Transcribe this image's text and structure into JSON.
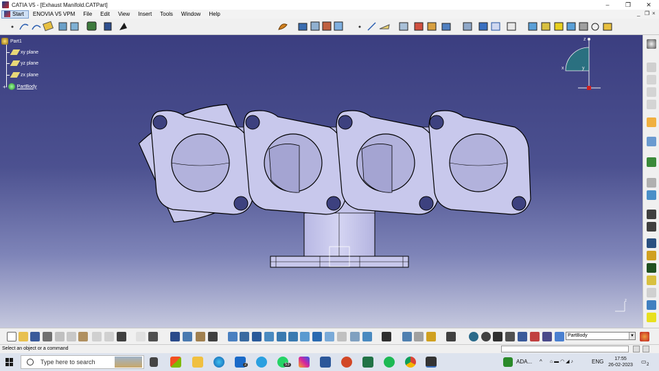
{
  "window": {
    "title": "CATIA V5 - [Exhaust Manifold.CATPart]",
    "controls": {
      "minimize": "–",
      "restore": "❐",
      "close": "✕"
    },
    "mdi_controls": {
      "minimize": "_",
      "restore": "❐",
      "close": "×"
    }
  },
  "menubar": {
    "items": [
      "Start",
      "ENOVIA V5 VPM",
      "File",
      "Edit",
      "View",
      "Insert",
      "Tools",
      "Window",
      "Help"
    ]
  },
  "tree": {
    "root": "Part1",
    "planes": [
      "xy plane",
      "yz plane",
      "zx plane"
    ],
    "body": "PartBody"
  },
  "compass": {
    "x_label": "x",
    "y_label": "y",
    "z_label": "z"
  },
  "axis_indicator": {
    "z_label": "z"
  },
  "toolbar_bottom": {
    "current_body": "PartBody"
  },
  "statusbar": {
    "message": "Select an object or a command"
  },
  "taskbar": {
    "search_placeholder": "Type here to search",
    "whatsapp_badge": "53",
    "mail_badge": "2",
    "tray_label": "ADA...",
    "language": "ENG",
    "time": "17:55",
    "date": "26-02-2023",
    "notification_count": "2"
  },
  "colors": {
    "viewport_top": "#3b3e80",
    "viewport_bottom": "#c5c8de",
    "part_fill": "#c8c8ec",
    "part_stroke": "#000000"
  }
}
